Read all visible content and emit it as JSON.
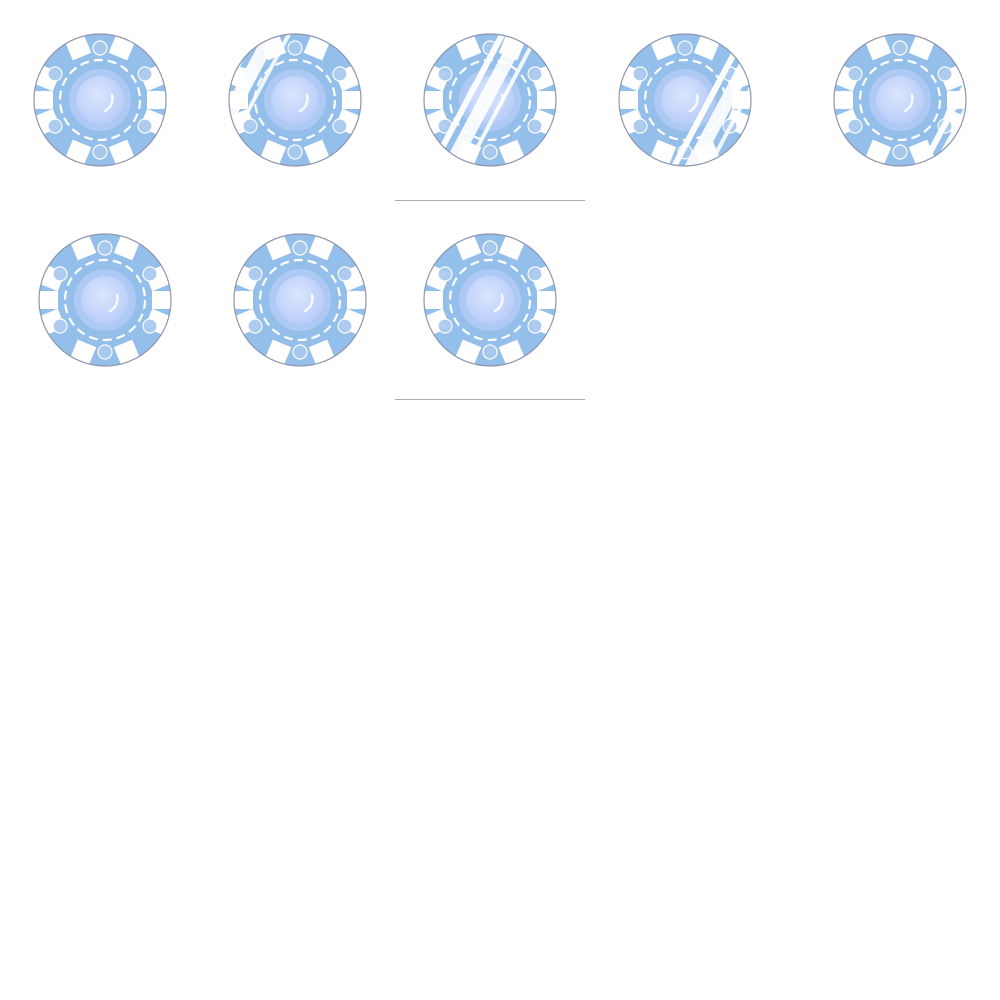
{
  "sprite_sheet": {
    "subject": "poker-chip-icon",
    "frame_count": 8,
    "colors": {
      "background": "#ffffff",
      "chip_body": "#94bfea",
      "chip_edge": "#8d94ae",
      "chip_stripe": "#ffffff",
      "chip_inset": "#a9caef",
      "center_light": "#dbe6ff",
      "center_mid": "#b8cdf8",
      "shine": "#ffffff",
      "divider": "#a9adbb"
    },
    "frames": [
      {
        "shine_offset": null
      },
      {
        "shine_offset": -0.45
      },
      {
        "shine_offset": -0.05
      },
      {
        "shine_offset": 0.3
      },
      {
        "shine_offset": 0.55
      },
      {
        "shine_offset": 0.75
      },
      {
        "shine_offset": 1.1
      },
      {
        "shine_offset": -0.9
      }
    ]
  }
}
